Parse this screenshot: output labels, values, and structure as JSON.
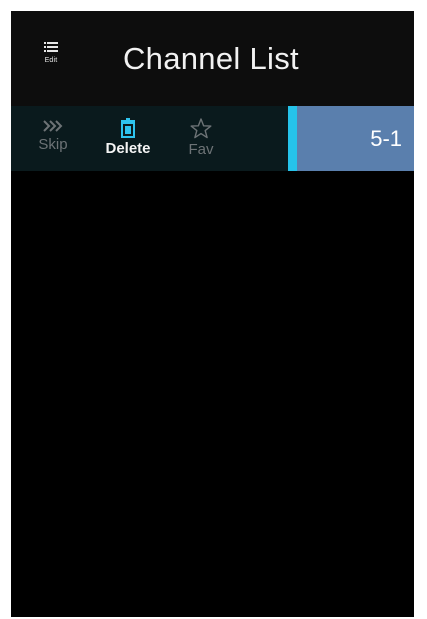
{
  "header": {
    "title": "Channel List",
    "edit_label": "Edit",
    "edit_icon": "list-edit-icon"
  },
  "toolbar": {
    "skip": {
      "label": "Skip",
      "icon": "skip-icon"
    },
    "delete": {
      "label": "Delete",
      "icon": "trash-icon"
    },
    "fav": {
      "label": "Fav",
      "icon": "star-icon"
    }
  },
  "channels": [
    {
      "number": "5-1",
      "selected": true
    }
  ],
  "colors": {
    "background": "#000000",
    "header": "#0d0d0d",
    "toolbar": "#0a1a1d",
    "selected_item": "#5a7fad",
    "accent": "#25c3ea",
    "delete_icon": "#2ec4ef",
    "inactive": "#6d7376"
  }
}
